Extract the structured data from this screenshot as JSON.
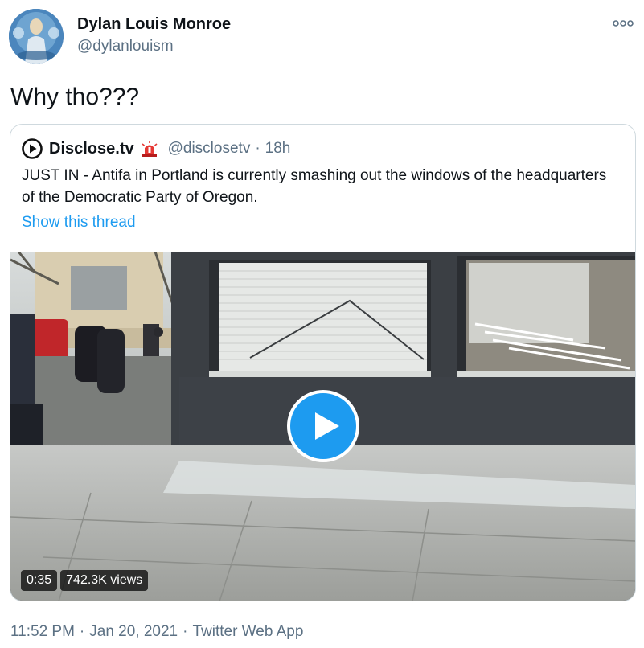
{
  "tweet": {
    "author": {
      "name": "Dylan Louis Monroe",
      "handle": "@dylanlouism"
    },
    "text": "Why tho???",
    "footer": {
      "time": "11:52 PM",
      "date": "Jan 20, 2021",
      "source": "Twitter Web App",
      "separator": "·"
    }
  },
  "quoted": {
    "name": "Disclose.tv",
    "badge_icon": "rotating-light-icon",
    "handle": "@disclosetv",
    "separator": "·",
    "time": "18h",
    "text": "JUST IN - Antifa in Portland is currently smashing out the windows of the headquarters of the Democratic Party of Oregon.",
    "thread_link": "Show this thread",
    "video": {
      "duration": "0:35",
      "views": "742.3K views"
    }
  },
  "colors": {
    "accent": "#1d9bf0",
    "secondary_text": "#5b7083",
    "border": "#cfd9de"
  }
}
